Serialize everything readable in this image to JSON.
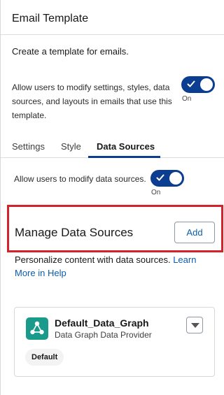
{
  "header": {
    "title": "Email Template"
  },
  "intro": "Create a template for emails.",
  "modify_settings": {
    "text": "Allow users to modify settings, styles, data sources, and layouts in emails that use this template.",
    "state": "On"
  },
  "tabs": [
    {
      "label": "Settings"
    },
    {
      "label": "Style"
    },
    {
      "label": "Data Sources"
    }
  ],
  "modify_data_sources": {
    "text": "Allow users to modify data sources.",
    "state": "On"
  },
  "manage": {
    "title": "Manage Data Sources",
    "add_label": "Add",
    "description": "Personalize content with data sources.",
    "link": "Learn More in Help"
  },
  "data_source_card": {
    "name": "Default_Data_Graph",
    "provider": "Data Graph Data Provider",
    "badge": "Default"
  },
  "colors": {
    "toggle_on": "#0b3d91",
    "highlight": "#d3222a",
    "link": "#0b5cab",
    "icon_bg": "#1a9a8a"
  }
}
